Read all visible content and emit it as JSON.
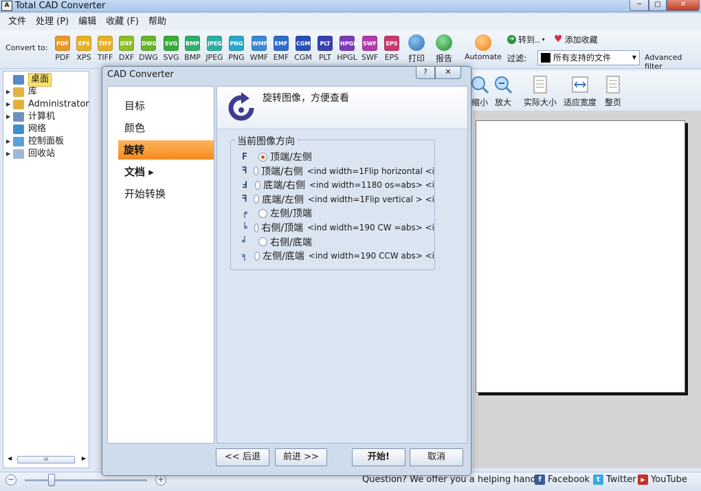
{
  "window": {
    "title": "Total CAD Converter",
    "icon": "A",
    "min": "─",
    "max": "□",
    "close": "✕"
  },
  "menu": [
    "文件",
    "处理 (P)",
    "编辑",
    "收藏 (F)",
    "帮助"
  ],
  "toolbar": {
    "convert_label": "Convert to:",
    "formats": [
      {
        "label": "PDF",
        "badge": "PDF",
        "color": "#e79a2a"
      },
      {
        "label": "XPS",
        "badge": "XPS",
        "color": "#e7b02a"
      },
      {
        "label": "TIFF",
        "badge": "TIFF",
        "color": "#e7b02a"
      },
      {
        "label": "DXF",
        "badge": "DXF",
        "color": "#8fbd2c"
      },
      {
        "label": "DWG",
        "badge": "DWG",
        "color": "#67b52a"
      },
      {
        "label": "SVG",
        "badge": "SVG",
        "color": "#3caa3a"
      },
      {
        "label": "BMP",
        "badge": "BMP",
        "color": "#2fae6b"
      },
      {
        "label": "JPEG",
        "badge": "JPEG",
        "color": "#2bb0a0"
      },
      {
        "label": "PNG",
        "badge": "PNG",
        "color": "#2aa6c7"
      },
      {
        "label": "WMF",
        "badge": "WMF",
        "color": "#3a87d3"
      },
      {
        "label": "EMF",
        "badge": "EMF",
        "color": "#2f6cc9"
      },
      {
        "label": "CGM",
        "badge": "CGM",
        "color": "#2b4eb8"
      },
      {
        "label": "PLT",
        "badge": "PLT",
        "color": "#3940b0"
      },
      {
        "label": "HPGL",
        "badge": "HPGL",
        "color": "#7b3cb8"
      },
      {
        "label": "SWF",
        "badge": "SWF",
        "color": "#b13aa8"
      },
      {
        "label": "EPS",
        "badge": "EPS",
        "color": "#c83a6e"
      }
    ],
    "print_label": "打印",
    "report_label": "报告",
    "automate_label": "Automate",
    "goto_label": "转到..",
    "fav_label": "添加收藏",
    "filter_label": "过滤:",
    "filter_value": "所有支持的文件",
    "advanced_filter": "Advanced filter"
  },
  "tree": {
    "items": [
      {
        "label": "桌面",
        "icon": "desktop-icon",
        "color": "#5a87c9",
        "selected": true,
        "expandable": false
      },
      {
        "label": "库",
        "icon": "library-icon",
        "color": "#e3b340",
        "expandable": true
      },
      {
        "label": "Administrator",
        "icon": "user-folder-icon",
        "color": "#e1b13c",
        "expandable": true
      },
      {
        "label": "计算机",
        "icon": "computer-icon",
        "color": "#6f92bf",
        "expandable": true
      },
      {
        "label": "网络",
        "icon": "network-icon",
        "color": "#3f8fd0",
        "expandable": false
      },
      {
        "label": "控制面板",
        "icon": "control-panel-icon",
        "color": "#5d9fd8",
        "expandable": true
      },
      {
        "label": "回收站",
        "icon": "recycle-bin-icon",
        "color": "#9fb8d6",
        "expandable": true
      }
    ],
    "scroll_grip": "III"
  },
  "viewer_tools": [
    {
      "label": "缩小",
      "icon": "zoom-out-icon"
    },
    {
      "label": "放大",
      "icon": "zoom-in-icon"
    },
    {
      "label": "实际大小",
      "icon": "actual-size-icon"
    },
    {
      "label": "适应宽度",
      "icon": "fit-width-icon"
    },
    {
      "label": "整页",
      "icon": "full-page-icon"
    }
  ],
  "dialog": {
    "title": "CAD Converter",
    "help": "?",
    "close": "✕",
    "nav": [
      {
        "label": "目标"
      },
      {
        "label": "颜色"
      },
      {
        "label": "旋转",
        "active": true
      },
      {
        "label": "文档 ▸",
        "bold": true
      },
      {
        "label": "开始转换"
      }
    ],
    "header_text": "旋转图像，方便查看",
    "group_title": "当前图像方向",
    "options": [
      {
        "glyph": "F",
        "label": "顶端/左侧",
        "extra": "",
        "selected": true
      },
      {
        "glyph": "ꟻ",
        "label": "顶端/右侧",
        "extra": "<ind width=1Flip horizontal <i"
      },
      {
        "glyph": "Ⅎ",
        "label": "底端/右侧",
        "extra": "<ind width=1180  os=abs> <i"
      },
      {
        "glyph": "ꟻ",
        "label": "底端/左侧",
        "extra": "<ind width=1Flip vertical > <i"
      },
      {
        "glyph": "╒",
        "label": "左侧/顶端",
        "extra": ""
      },
      {
        "glyph": "╘",
        "label": "右侧/顶端",
        "extra": "<ind width=190 CW =abs> <i"
      },
      {
        "glyph": "╛",
        "label": "右侧/底端",
        "extra": ""
      },
      {
        "glyph": "╕",
        "label": "左侧/底端",
        "extra": "<ind width=190 CCW abs> <i"
      }
    ],
    "buttons": {
      "back": "<< 后退",
      "next": "前进 >>",
      "start": "开始!",
      "cancel": "取消"
    }
  },
  "status": {
    "zoom_minus": "−",
    "zoom_plus": "+",
    "zoom_level": 0.22,
    "help_text": "Question? We offer you a helping hand -",
    "facebook": "Facebook",
    "twitter": "Twitter",
    "youtube": "YouTube"
  }
}
